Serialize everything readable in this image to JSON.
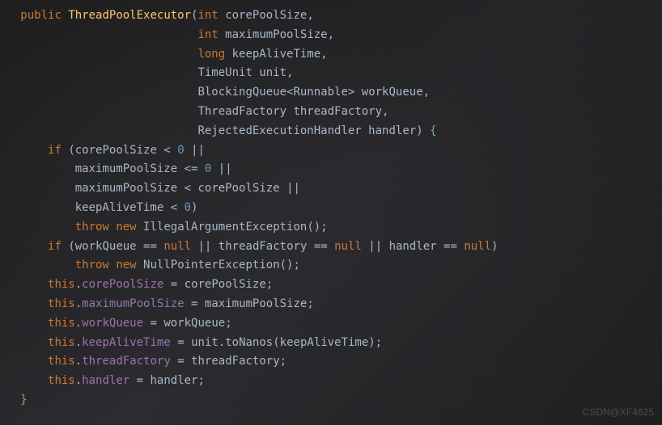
{
  "code": {
    "l1": {
      "kw_public": "public",
      "method": "ThreadPoolExecutor",
      "type_int": "int",
      "p1": "corePoolSize"
    },
    "l2": {
      "type_int": "int",
      "p": "maximumPoolSize"
    },
    "l3": {
      "type_long": "long",
      "p": "keepAliveTime"
    },
    "l4": {
      "type": "TimeUnit",
      "p": "unit"
    },
    "l5": {
      "type": "BlockingQueue",
      "gen": "Runnable",
      "p": "workQueue"
    },
    "l6": {
      "type": "ThreadFactory",
      "p": "threadFactory"
    },
    "l7": {
      "type": "RejectedExecutionHandler",
      "p": "handler"
    },
    "l8": {
      "kw_if": "if",
      "id": "corePoolSize",
      "op": "<",
      "num": "0",
      "or": "||"
    },
    "l9": {
      "id": "maximumPoolSize",
      "op": "<=",
      "num": "0",
      "or": "||"
    },
    "l10": {
      "id1": "maximumPoolSize",
      "op": "<",
      "id2": "corePoolSize",
      "or": "||"
    },
    "l11": {
      "id": "keepAliveTime",
      "op": "<",
      "num": "0"
    },
    "l12": {
      "kw_throw": "throw",
      "kw_new": "new",
      "type": "IllegalArgumentException"
    },
    "l13": {
      "kw_if": "if",
      "id1": "workQueue",
      "eq": "==",
      "null": "null",
      "or": "||",
      "id2": "threadFactory",
      "id3": "handler"
    },
    "l14": {
      "kw_throw": "throw",
      "kw_new": "new",
      "type": "NullPointerException"
    },
    "l15": {
      "kw_this": "this",
      "field": "corePoolSize",
      "eq": "=",
      "id": "corePoolSize"
    },
    "l16": {
      "kw_this": "this",
      "field": "maximumPoolSize",
      "eq": "=",
      "id": "maximumPoolSize"
    },
    "l17": {
      "kw_this": "this",
      "field": "workQueue",
      "eq": "=",
      "id": "workQueue"
    },
    "l18": {
      "kw_this": "this",
      "field": "keepAliveTime",
      "eq": "=",
      "id": "unit",
      "m": "toNanos",
      "arg": "keepAliveTime"
    },
    "l19": {
      "kw_this": "this",
      "field": "threadFactory",
      "eq": "=",
      "id": "threadFactory"
    },
    "l20": {
      "kw_this": "this",
      "field": "handler",
      "eq": "=",
      "id": "handler"
    }
  },
  "watermark": "CSDN@XF4625"
}
